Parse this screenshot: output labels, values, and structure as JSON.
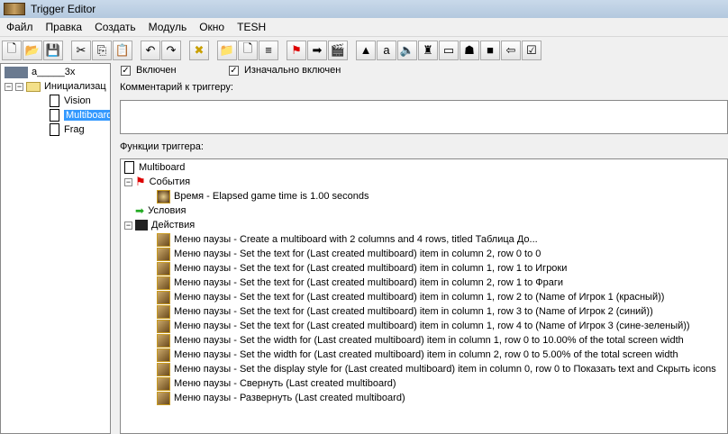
{
  "window": {
    "title": "Trigger Editor"
  },
  "menu": [
    "Файл",
    "Правка",
    "Создать",
    "Модуль",
    "Окно",
    "TESH"
  ],
  "toolbar": [
    "new-doc-icon",
    "open-folder-icon",
    "save-icon",
    "cut-icon",
    "copy-icon",
    "paste-icon",
    "undo-icon",
    "redo-icon",
    "delete-icon",
    "new-category-icon",
    "new-trigger-icon",
    "new-comment-icon",
    "new-event-icon",
    "new-condition-icon",
    "new-action-icon",
    "terrain-editor-icon",
    "trigger-editor-icon",
    "sound-editor-icon",
    "object-editor-icon",
    "campaign-editor-icon",
    "ai-editor-icon",
    "import-manager-icon",
    "export-icon",
    "test-map-icon"
  ],
  "tree": {
    "root": "a_____3x",
    "category": "Инициализац",
    "triggers": [
      "Vision",
      "Multiboard",
      "Frag"
    ],
    "selected": "Multiboard"
  },
  "trigger": {
    "enabled_label": "Включен",
    "initially_on_label": "Изначально включен",
    "comment_label": "Комментарий к триггеру:",
    "comment": "",
    "functions_label": "Функции триггера:"
  },
  "functions": {
    "name": "Multiboard",
    "events_label": "События",
    "events": [
      "Время - Elapsed game time is 1.00 seconds"
    ],
    "conditions_label": "Условия",
    "actions_label": "Действия",
    "actions": [
      "Меню паузы - Create a multiboard with 2 columns and 4 rows, titled Таблица До...",
      "Меню паузы - Set the text for (Last created multiboard) item in column 2, row 0 to 0",
      "Меню паузы - Set the text for (Last created multiboard) item in column 1, row 1 to Игроки",
      "Меню паузы - Set the text for (Last created multiboard) item in column 2, row 1 to Фраги",
      "Меню паузы - Set the text for (Last created multiboard) item in column 1, row 2 to (Name of Игрок 1 (красный))",
      "Меню паузы - Set the text for (Last created multiboard) item in column 1, row 3 to (Name of Игрок 2 (синий))",
      "Меню паузы - Set the text for (Last created multiboard) item in column 1, row 4 to (Name of Игрок 3 (сине-зеленый))",
      "Меню паузы - Set the width for (Last created multiboard) item in column 1, row 0 to 10.00% of the total screen width",
      "Меню паузы - Set the width for (Last created multiboard) item in column 2, row 0 to 5.00% of the total screen width",
      "Меню паузы - Set the display style for (Last created multiboard) item in column 0, row 0 to Показать text and Скрыть icons",
      "Меню паузы - Свернуть (Last created multiboard)",
      "Меню паузы - Развернуть (Last created multiboard)"
    ]
  }
}
